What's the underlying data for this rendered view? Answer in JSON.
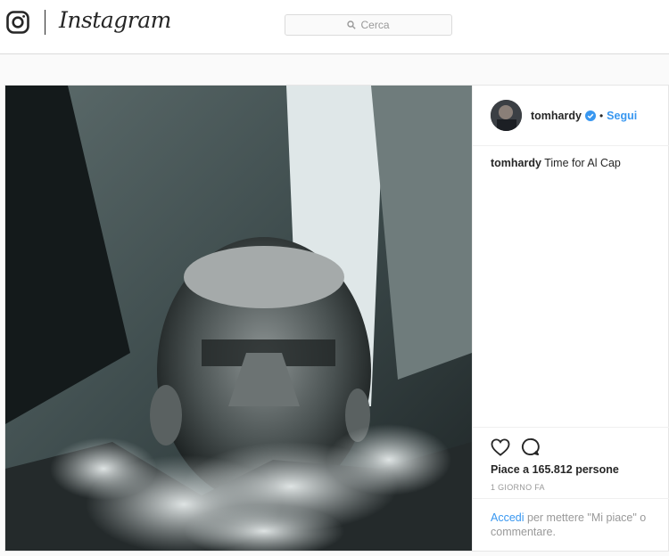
{
  "header": {
    "brand": "Instagram",
    "logo_icon": "instagram-camera-icon",
    "search_placeholder": "Cerca",
    "search_icon": "search-icon"
  },
  "post": {
    "photo_description": "Black and white photo of a man exhaling smoke",
    "author": {
      "username": "tomhardy",
      "verified": true,
      "verified_icon": "verified-badge-icon",
      "separator": "•",
      "follow_label": "Segui"
    },
    "caption": {
      "username": "tomhardy",
      "text": "Time for Al Cap"
    },
    "actions": {
      "like_icon": "heart-icon",
      "comment_icon": "comment-icon"
    },
    "likes_text": "Piace a 165.812 persone",
    "timestamp": "1 GIORNO FA",
    "login_prompt": {
      "link": "Accedi",
      "text": "per mettere \"Mi piace\" o commentare."
    }
  },
  "colors": {
    "accent": "#3897f0",
    "text": "#262626",
    "muted": "#999999",
    "border": "#dbdbdb",
    "background": "#fafafa"
  }
}
